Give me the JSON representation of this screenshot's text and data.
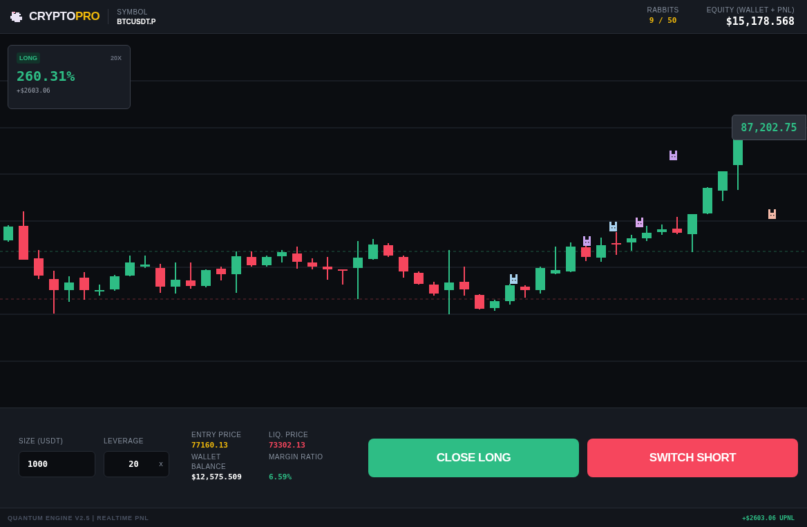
{
  "header": {
    "logo": {
      "first": "CRYPTO",
      "second": "PRO"
    },
    "symbol": {
      "label": "SYMBOL",
      "value": "BTCUSDT.P"
    },
    "stats": [
      {
        "label": "RABBITS",
        "value": "9 / 50",
        "color": "#f0b90b"
      },
      {
        "label": "EQUITY (WALLET + PNL)",
        "value": "$15,178.568",
        "color": "#ffffff"
      }
    ]
  },
  "position": {
    "side": "LONG",
    "kind": "long",
    "leverage": "20X",
    "pnl_percent": "260.31%",
    "pnl_usd": "+$2603.06"
  },
  "price_label": "87,202.75",
  "controls": {
    "fields": [
      {
        "label": "SIZE (USDT)",
        "value": "1000"
      },
      {
        "label": "LEVERAGE",
        "value": "20",
        "suffix": "x"
      }
    ],
    "stats": [
      {
        "label": "ENTRY PRICE",
        "value": "77160.13",
        "color": "#f0b90b"
      },
      {
        "label": "LIQ. PRICE",
        "value": "73302.13",
        "color": "#f6465d"
      },
      {
        "label": "WALLET BALANCE",
        "value": "$12,575.509",
        "color": "#ffffff"
      },
      {
        "label": "MARGIN RATIO",
        "value": "6.59%",
        "color": "#2ebd85"
      }
    ],
    "buttons": [
      {
        "label": "CLOSE LONG",
        "color": "#2ebd85"
      },
      {
        "label": "SWITCH SHORT",
        "color": "#f6465d"
      }
    ]
  },
  "footer": {
    "left": "QUANTUM ENGINE V2.5 | REALTIME PNL",
    "right": "+$2603.06 UPNL"
  }
}
